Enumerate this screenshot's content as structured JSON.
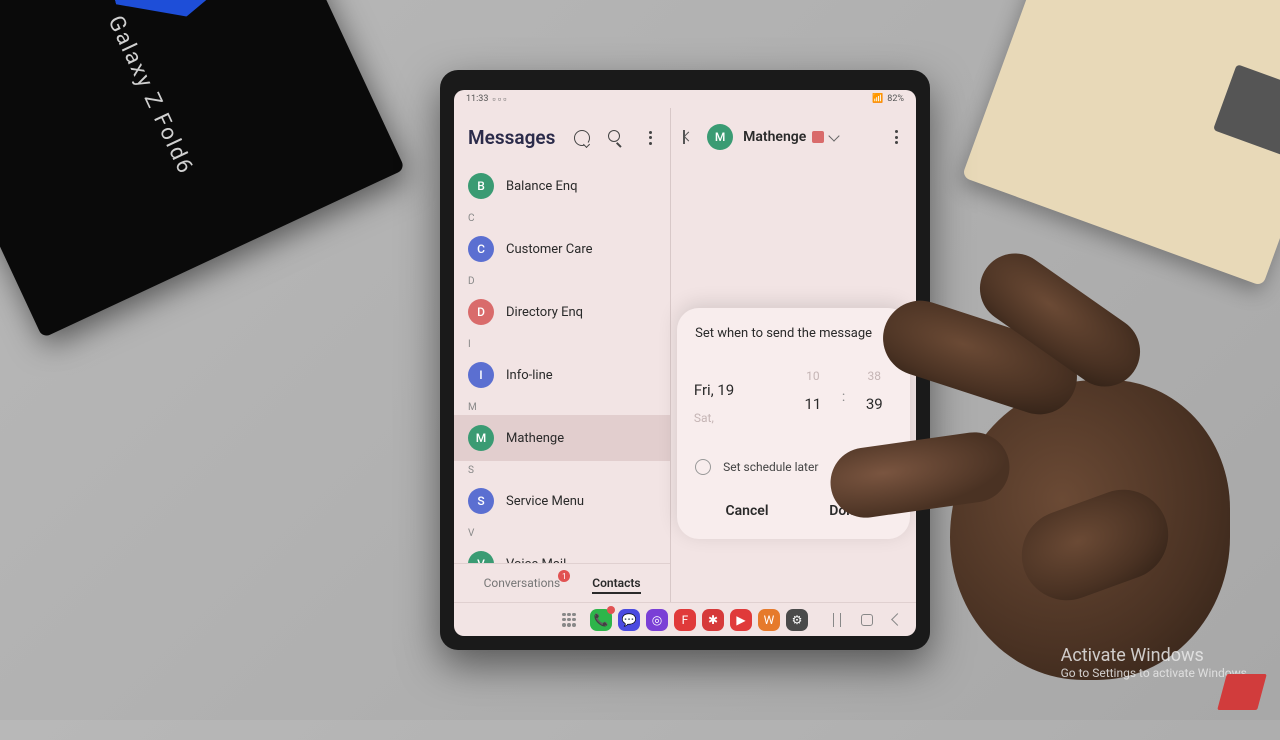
{
  "status": {
    "time": "11:33",
    "battery": "82%"
  },
  "box": {
    "product": "Galaxy Z Fold6"
  },
  "leftPane": {
    "title": "Messages",
    "sections": [
      {
        "letter": "",
        "items": [
          {
            "initial": "B",
            "color": "#3a9b73",
            "name": "Balance Enq"
          }
        ]
      },
      {
        "letter": "C",
        "items": [
          {
            "initial": "C",
            "color": "#5b6fd1",
            "name": "Customer Care"
          }
        ]
      },
      {
        "letter": "D",
        "items": [
          {
            "initial": "D",
            "color": "#d96b6b",
            "name": "Directory Enq"
          }
        ]
      },
      {
        "letter": "I",
        "items": [
          {
            "initial": "I",
            "color": "#5b6fd1",
            "name": "Info-line"
          }
        ]
      },
      {
        "letter": "M",
        "items": [
          {
            "initial": "M",
            "color": "#3a9b73",
            "name": "Mathenge",
            "selected": true
          }
        ]
      },
      {
        "letter": "S",
        "items": [
          {
            "initial": "S",
            "color": "#5b6fd1",
            "name": "Service Menu"
          }
        ]
      },
      {
        "letter": "V",
        "items": [
          {
            "initial": "V",
            "color": "#3a9b73",
            "name": "Voice Mail"
          }
        ]
      }
    ],
    "tabs": {
      "conversations": "Conversations",
      "conv_badge": "1",
      "contacts": "Contacts"
    }
  },
  "rightPane": {
    "contact": {
      "initial": "M",
      "color": "#3a9b73",
      "name": "Mathenge"
    }
  },
  "modal": {
    "title": "Set when to send the message",
    "date_prev": "",
    "date_sel": "Fri, 19",
    "date_next": "Sat,",
    "hour_prev": "10",
    "hour_sel": "11",
    "hour_next": "",
    "min_prev": "38",
    "min_sel": "39",
    "min_next": "",
    "schedule_later": "Set schedule later",
    "cancel": "Cancel",
    "done": "Done"
  },
  "taskbar": {
    "apps": [
      {
        "bg": "#2db54a",
        "glyph": "📞",
        "badge": true
      },
      {
        "bg": "#4a4ae0",
        "glyph": "💬"
      },
      {
        "bg": "#7a3fd6",
        "glyph": "◎"
      },
      {
        "bg": "#e03a3a",
        "glyph": "F"
      },
      {
        "bg": "#d63a3a",
        "glyph": "✱"
      },
      {
        "bg": "#e03a3a",
        "glyph": "▶"
      },
      {
        "bg": "#e67a2b",
        "glyph": "W"
      },
      {
        "bg": "#4a4a4a",
        "glyph": "⚙"
      }
    ]
  },
  "watermark": {
    "title": "Activate Windows",
    "sub": "Go to Settings to activate Windows."
  }
}
